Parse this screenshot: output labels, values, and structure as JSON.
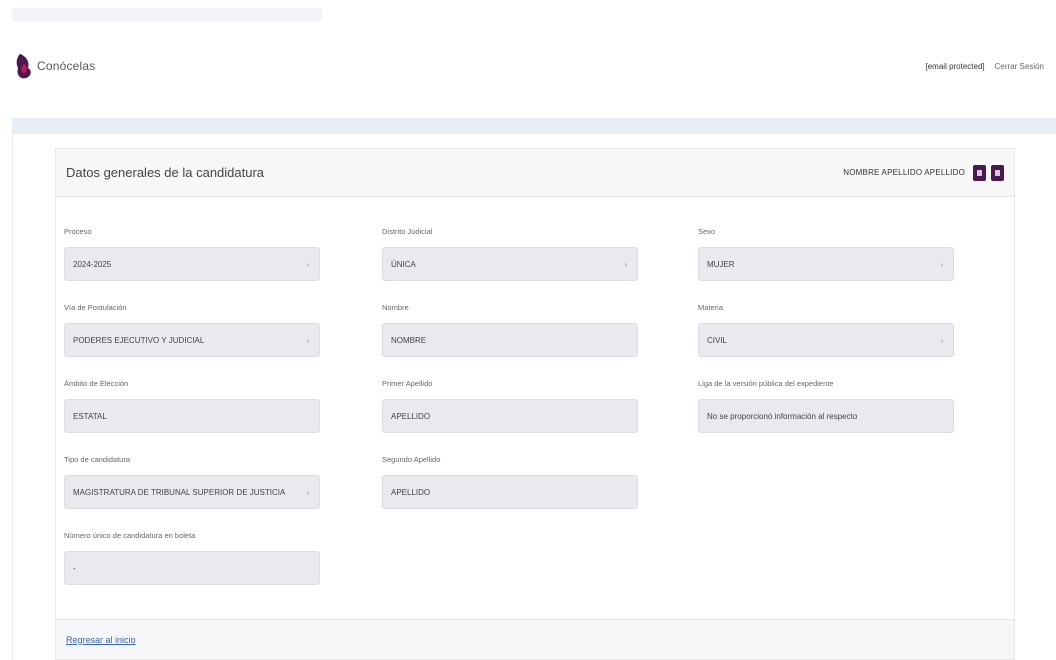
{
  "header": {
    "brand": "Conócelas",
    "user_email": "[email protected]",
    "logout": "Cerrar Sesión"
  },
  "card": {
    "title": "Datos generales de la candidatura",
    "candidate_name": "NOMBRE APELLIDO APELLIDO"
  },
  "fields": {
    "proceso": {
      "label": "Proceso",
      "value": "2024-2025"
    },
    "distrito": {
      "label": "Distrito Judicial",
      "value": "ÚNICA"
    },
    "sexo": {
      "label": "Sexo",
      "value": "MUJER"
    },
    "via": {
      "label": "Vía de Postulación",
      "value": "PODERES EJECUTIVO Y JUDICIAL"
    },
    "nombre": {
      "label": "Nombre",
      "value": "NOMBRE"
    },
    "materia": {
      "label": "Materia",
      "value": "CIVIL"
    },
    "ambito": {
      "label": "Ámbito de Elección",
      "value": "ESTATAL"
    },
    "primer_apellido": {
      "label": "Primer Apellido",
      "value": "APELLIDO"
    },
    "liga": {
      "label": "Liga de la versión pública del expediente",
      "value": "No se proporcionó información al respecto"
    },
    "tipo": {
      "label": "Tipo de candidatura",
      "value": "MAGISTRATURA DE TRIBUNAL SUPERIOR DE JUSTICIA"
    },
    "segundo_apellido": {
      "label": "Segundo Apellido",
      "value": "APELLIDO"
    },
    "numero": {
      "label": "Número único de candidatura en boleta",
      "value": "-"
    }
  },
  "footer": {
    "back_link": "Regresar al inicio"
  },
  "icons": {
    "chevron": "chevron-down-icon",
    "prev": "prev-icon",
    "next": "next-icon"
  },
  "colors": {
    "brand": "#4a1a4e",
    "field_bg": "#e9eaee",
    "link": "#3a66b0"
  }
}
